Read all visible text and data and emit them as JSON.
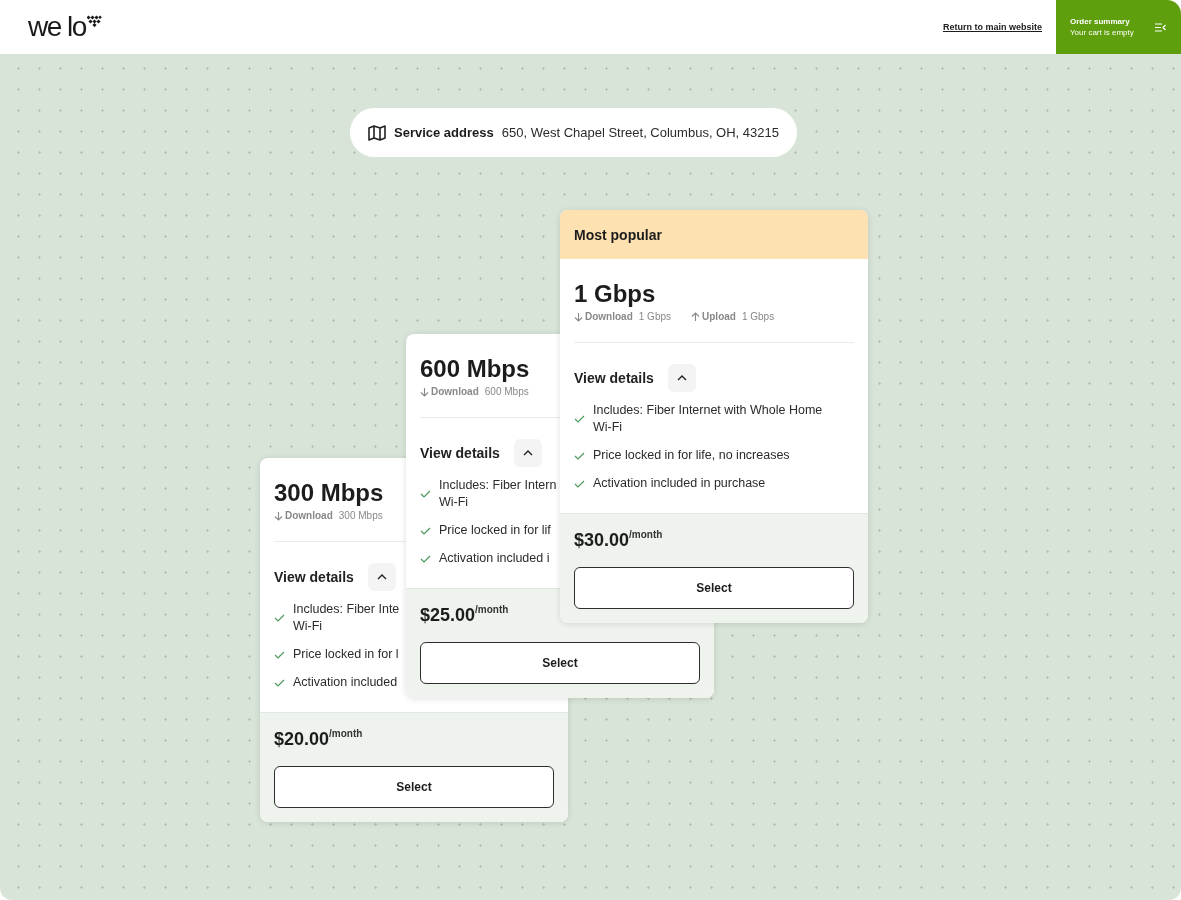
{
  "header": {
    "logo": "we lo",
    "return_link": "Return to main website",
    "order_summary": {
      "title": "Order summary",
      "subtitle": "Your cart is empty"
    }
  },
  "service_address": {
    "label": "Service address",
    "value": "650, West Chapel Street, Columbus, OH, 43215"
  },
  "plans": [
    {
      "title": "300 Mbps",
      "speeds": [
        {
          "kind": "down",
          "label": "Download",
          "value": "300 Mbps"
        }
      ],
      "details_label": "View details",
      "expanded": true,
      "features": [
        {
          "lines": [
            "Includes: Fiber Inte",
            "Wi-Fi"
          ]
        },
        {
          "lines": [
            "Price locked in for l"
          ]
        },
        {
          "lines": [
            "Activation included"
          ]
        }
      ],
      "price": "$20.00",
      "period": "/month",
      "button": "Select"
    },
    {
      "title": "600 Mbps",
      "speeds": [
        {
          "kind": "down",
          "label": "Download",
          "value": "600 Mbps"
        }
      ],
      "details_label": "View details",
      "expanded": true,
      "features": [
        {
          "lines": [
            "Includes: Fiber Intern",
            "Wi-Fi"
          ]
        },
        {
          "lines": [
            "Price locked in for lif"
          ]
        },
        {
          "lines": [
            "Activation included i"
          ]
        }
      ],
      "price": "$25.00",
      "period": "/month",
      "button": "Select"
    },
    {
      "badge": "Most popular",
      "title": "1 Gbps",
      "speeds": [
        {
          "kind": "down",
          "label": "Download",
          "value": "1 Gbps"
        },
        {
          "kind": "up",
          "label": "Upload",
          "value": "1 Gbps"
        }
      ],
      "details_label": "View details",
      "expanded": true,
      "features": [
        {
          "lines": [
            "Includes: Fiber Internet with Whole Home",
            "Wi-Fi"
          ]
        },
        {
          "lines": [
            "Price locked in for life, no increases"
          ]
        },
        {
          "lines": [
            "Activation included in purchase"
          ]
        }
      ],
      "price": "$30.00",
      "period": "/month",
      "button": "Select"
    }
  ]
}
